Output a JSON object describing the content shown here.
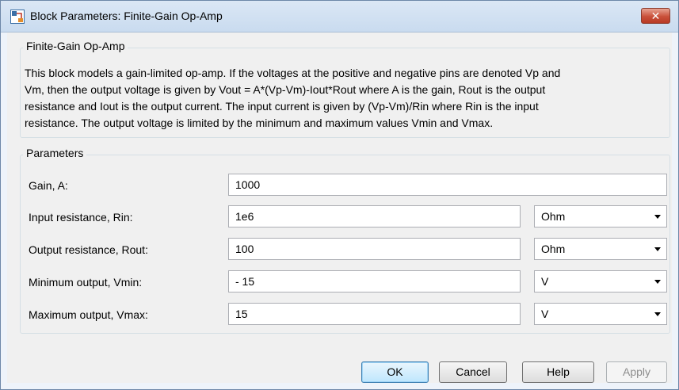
{
  "window": {
    "title": "Block Parameters: Finite-Gain Op-Amp",
    "close_glyph": "✕"
  },
  "block": {
    "group_title": "Finite-Gain Op-Amp",
    "description_lines": [
      "This block models a gain-limited op-amp. If the voltages at the positive and negative pins are denoted Vp and",
      "Vm, then the output voltage is given by Vout = A*(Vp-Vm)-Iout*Rout where A is the gain, Rout is the output",
      "resistance and Iout is the output current. The input current is given by (Vp-Vm)/Rin where Rin is the input",
      "resistance. The output voltage is limited by the minimum and maximum values Vmin and Vmax."
    ]
  },
  "parameters": {
    "group_title": "Parameters",
    "rows": [
      {
        "label": "Gain, A:",
        "value": "1000",
        "unit": null
      },
      {
        "label": "Input resistance, Rin:",
        "value": "1e6",
        "unit": "Ohm"
      },
      {
        "label": "Output resistance, Rout:",
        "value": "100",
        "unit": "Ohm"
      },
      {
        "label": "Minimum output, Vmin:",
        "value": "- 15",
        "unit": "V"
      },
      {
        "label": "Maximum output, Vmax:",
        "value": "15",
        "unit": "V"
      }
    ]
  },
  "buttons": {
    "ok": "OK",
    "cancel": "Cancel",
    "help": "Help",
    "apply": "Apply"
  },
  "colors": {
    "titlebar": "#c9dbef",
    "close": "#c9503a",
    "default_button": "#bee6fd"
  }
}
